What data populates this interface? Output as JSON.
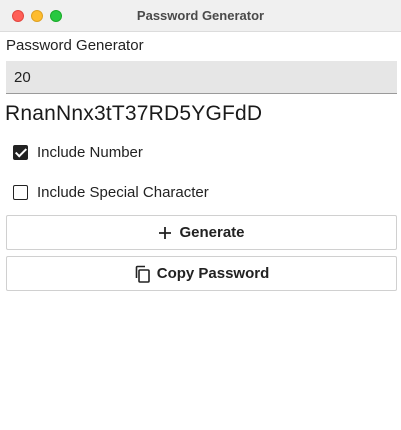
{
  "window": {
    "title": "Password Generator"
  },
  "form": {
    "label": "Password Generator",
    "length_value": "20"
  },
  "generated_password": "RnanNnx3tT37RD5YGFdD",
  "options": {
    "include_number": {
      "label": "Include Number",
      "checked": true
    },
    "include_special": {
      "label": "Include Special Character",
      "checked": false
    }
  },
  "buttons": {
    "generate": {
      "label": "Generate",
      "icon": "plus-icon"
    },
    "copy": {
      "label": "Copy Password",
      "icon": "copy-icon"
    }
  },
  "colors": {
    "close": "#ff5f57",
    "minimize": "#febc2e",
    "maximize": "#28c840",
    "field_bg": "#e6e6e6"
  }
}
